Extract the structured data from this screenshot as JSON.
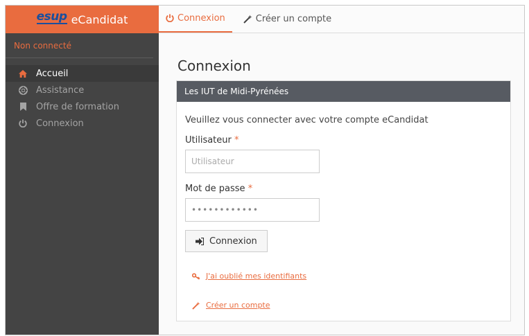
{
  "brand": {
    "logo_text": "esup",
    "name": "eCandidat"
  },
  "sidebar": {
    "status": "Non connecté",
    "items": [
      {
        "label": "Accueil",
        "icon": "home-icon",
        "active": true
      },
      {
        "label": "Assistance",
        "icon": "lifebuoy-icon",
        "active": false
      },
      {
        "label": "Offre de formation",
        "icon": "bookmark-icon",
        "active": false
      },
      {
        "label": "Connexion",
        "icon": "power-icon",
        "active": false
      }
    ]
  },
  "topbar": {
    "tabs": [
      {
        "label": "Connexion",
        "icon": "power-icon",
        "active": true
      },
      {
        "label": "Créer un compte",
        "icon": "magic-wand-icon",
        "active": false
      }
    ]
  },
  "main": {
    "title": "Connexion",
    "panel": {
      "header": "Les IUT de Midi-Pyrénées",
      "intro": "Veuillez vous connecter avec votre compte eCandidat",
      "username_label": "Utilisateur",
      "username_placeholder": "Utilisateur",
      "username_value": "",
      "password_label": "Mot de passe",
      "password_value": "••••••••••••",
      "required_marker": "*",
      "submit_label": "Connexion",
      "forgot_link": "J'ai oublié mes identifiants",
      "create_link": "Créer un compte"
    }
  },
  "colors": {
    "accent": "#e96c3f",
    "sidebar_bg": "#444444",
    "panel_header_bg": "#575b62",
    "logo_blue": "#1a4f9e"
  }
}
